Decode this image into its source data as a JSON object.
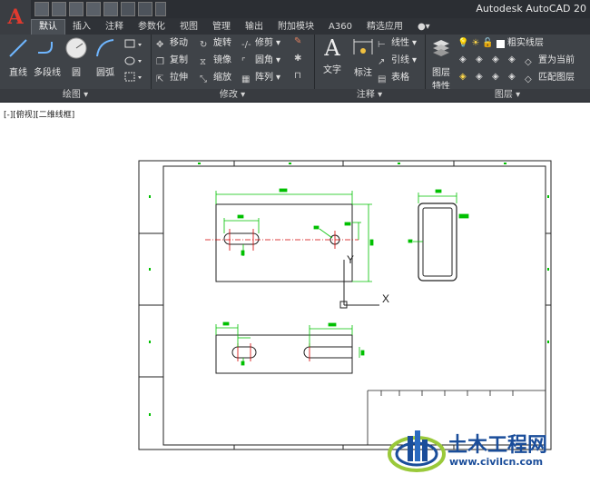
{
  "window": {
    "app_name": "Autodesk AutoCAD 20"
  },
  "quick_access": [
    "new-icon",
    "open-icon",
    "save-icon",
    "saveas-icon",
    "plot-icon",
    "undo-icon",
    "redo-icon",
    "dropdown-icon"
  ],
  "tabs": [
    {
      "label": "默认"
    },
    {
      "label": "插入"
    },
    {
      "label": "注释"
    },
    {
      "label": "参数化"
    },
    {
      "label": "视图"
    },
    {
      "label": "管理"
    },
    {
      "label": "输出"
    },
    {
      "label": "附加模块"
    },
    {
      "label": "A360"
    },
    {
      "label": "精选应用"
    }
  ],
  "ribbon": {
    "draw": {
      "title": "绘图",
      "line": "直线",
      "polyline": "多段线",
      "circle": "圆",
      "arc": "圆弧"
    },
    "modify": {
      "title": "修改",
      "move": "移动",
      "rotate": "旋转",
      "trim": "修剪",
      "copy": "复制",
      "mirror": "镜像",
      "fillet": "圆角",
      "stretch": "拉伸",
      "scale": "缩放",
      "array": "阵列"
    },
    "annotation": {
      "title": "注释",
      "text": "文字",
      "dimension": "标注",
      "linear": "线性",
      "leader": "引线",
      "table": "表格"
    },
    "layers": {
      "title": "图层",
      "properties_1": "图层",
      "properties_2": "特性",
      "current_layer": "粗实线层",
      "set_current": "置为当前",
      "match": "匹配图层"
    }
  },
  "viewport": {
    "label": "[-][俯视][二维线框]"
  },
  "ucs": {
    "x": "X",
    "y": "Y"
  },
  "watermark": {
    "title": "土木工程网",
    "url": "www.civilcn.com"
  },
  "colors": {
    "ribbon_bg": "#3f4348",
    "title_bg": "#2b2e33",
    "dim_green": "#00c000",
    "center_red": "#d40000",
    "brand_blue": "#1a4d9a"
  }
}
